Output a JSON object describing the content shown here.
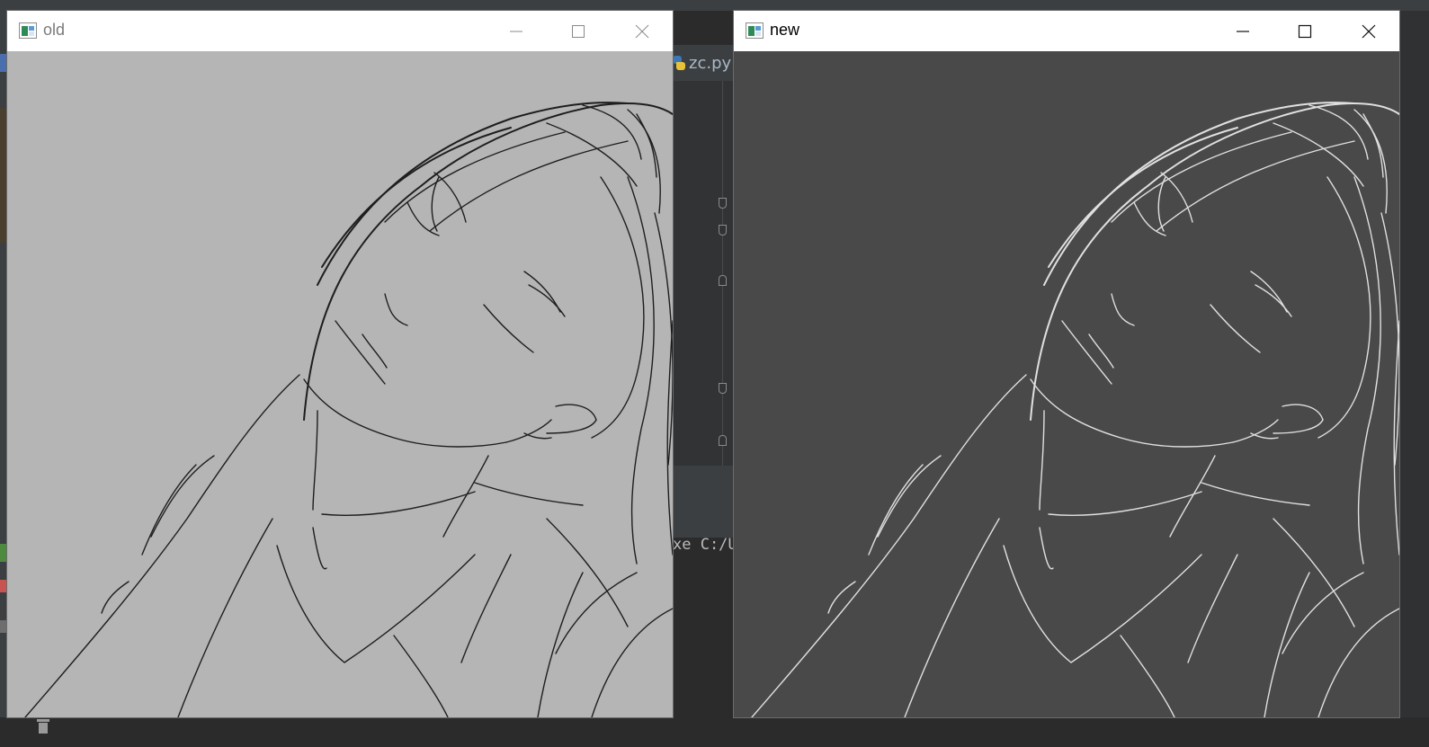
{
  "ide": {
    "tab_label": "zc.py",
    "console_text": "xe C:/U"
  },
  "windows": [
    {
      "title": "old",
      "background": "#b5b5b5",
      "stroke": "#1e1e1e",
      "title_color": "#7a7a7a"
    },
    {
      "title": "new",
      "background": "#494949",
      "stroke": "#e0e0e0",
      "title_color": "#000000"
    }
  ],
  "icons": {
    "app": "window-app-icon",
    "minimize": "minimize-icon",
    "maximize": "maximize-icon",
    "close": "close-icon",
    "python_file": "python-file-icon",
    "trash": "trash-icon"
  }
}
